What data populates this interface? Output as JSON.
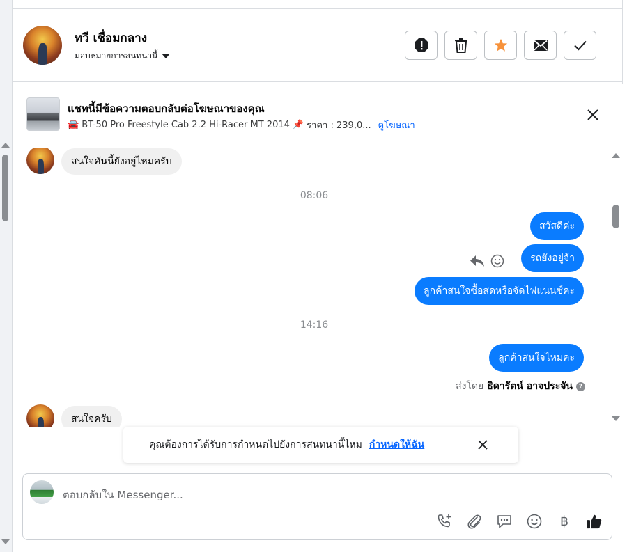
{
  "header": {
    "name": "ทวี เชื่อมกลาง",
    "assign_label": "มอบหมายการสนทนานี้",
    "action_icons": [
      "alert-icon",
      "trash-icon",
      "star-icon",
      "mail-icon",
      "check-icon"
    ],
    "star_color": "#f7923b"
  },
  "ad": {
    "title": "แชทนี้มีข้อความตอบกลับต่อโฆษณาของคุณ",
    "car_emoji": "🚘",
    "listing": "BT-50 Pro Freestyle Cab 2.2 Hi-Racer MT 2014",
    "pin_emoji": "📌",
    "price": "ราคา : 239,0...",
    "view_link": "ดูโฆษณา"
  },
  "thread": {
    "msg_in_1": "สนใจคันนี้ยังอยู่ไหมครับ",
    "time_1": "08:06",
    "msg_out_1": "สวัสดีค่ะ",
    "msg_out_2": "รถยังอยู่จ้า",
    "msg_out_3": "ลูกค้าสนใจซื้อสดหรือจัดไฟแนนซ์คะ",
    "time_2": "14:16",
    "msg_out_4": "ลูกค้าสนใจไหมคะ",
    "sent_by_prefix": "ส่งโดย",
    "sent_by_name": "ธิดารัตน์ อาจประจัน",
    "msg_in_2": "สนใจครับ",
    "outgoing_color": "#0a7cff"
  },
  "notice": {
    "text": "คุณต้องการได้รับการกำหนดไปยังการสนทนานี้ไหม",
    "link": "กำหนดให้ฉัน"
  },
  "composer": {
    "placeholder": "ตอบกลับใน Messenger...",
    "currency_symbol": "฿",
    "tool_icons": [
      "phone-plus-icon",
      "paperclip-icon",
      "message-icon",
      "emoji-icon",
      "baht-icon",
      "thumbs-up-icon"
    ]
  }
}
